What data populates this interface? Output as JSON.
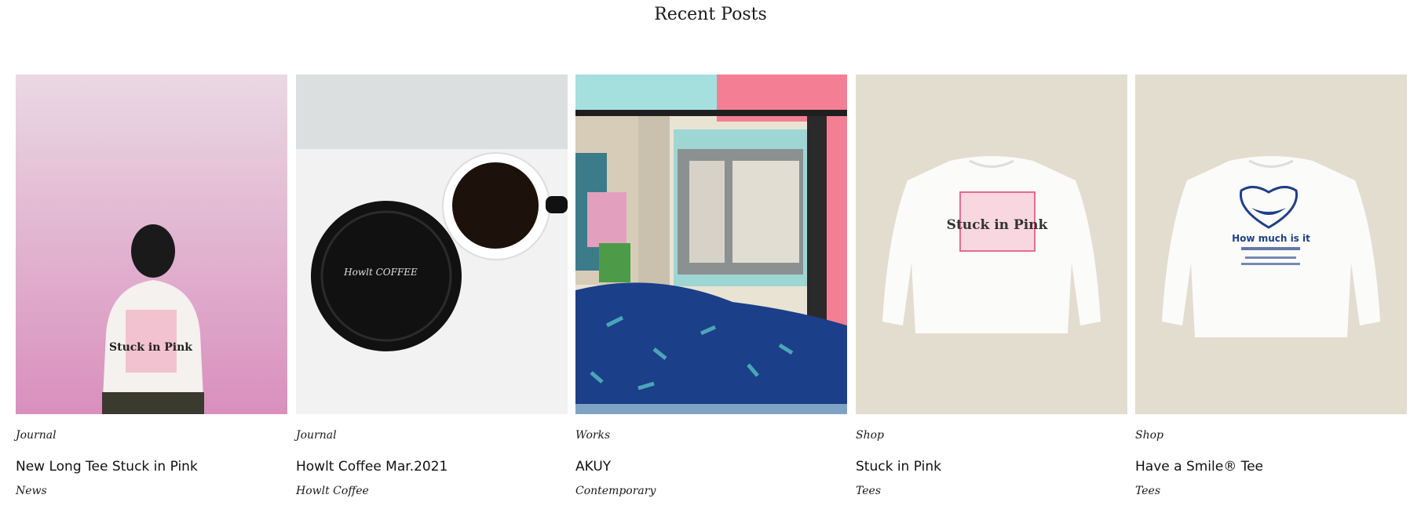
{
  "section": {
    "heading": "Recent Posts"
  },
  "posts": [
    {
      "category": "Journal",
      "title": "New Long Tee Stuck in Pink",
      "subcategory": "News",
      "image": "person-pink-wall-photo",
      "print_text": "Stuck in Pink"
    },
    {
      "category": "Journal",
      "title": "Howlt Coffee Mar.2021",
      "subcategory": "Howlt Coffee",
      "image": "coffee-cup-saucer-photo",
      "print_text": "Howlt COFFEE"
    },
    {
      "category": "Works",
      "title": "AKUY",
      "subcategory": "Contemporary",
      "image": "room-illustration",
      "print_text": ""
    },
    {
      "category": "Shop",
      "title": "Stuck in Pink",
      "subcategory": "Tees",
      "image": "white-longsleeve-pink-print",
      "print_text": "Stuck in Pink"
    },
    {
      "category": "Shop",
      "title": "Have a Smile® Tee",
      "subcategory": "Tees",
      "image": "white-longsleeve-blue-print",
      "print_text": "How much is it"
    }
  ],
  "colors": {
    "text": "#111111",
    "pink_wall": "#e6c6d8",
    "beige": "#e3ddd0",
    "navy": "#1f3f88",
    "pink_print": "#e86a93"
  }
}
